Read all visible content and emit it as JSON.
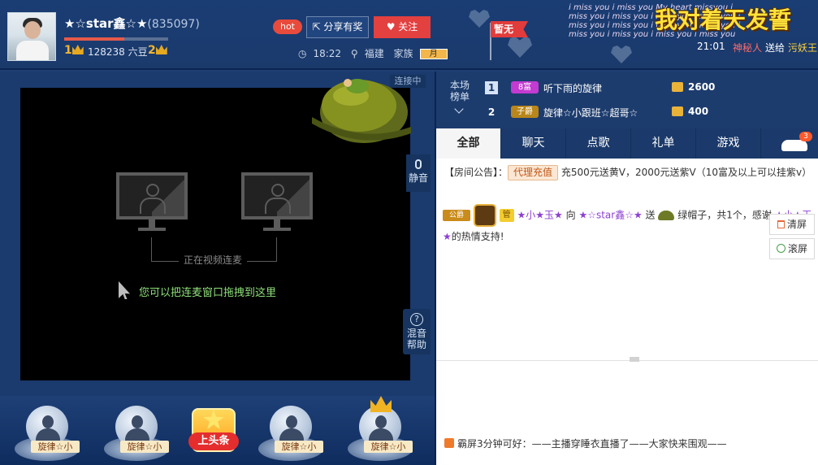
{
  "header": {
    "anchor_name": "★☆star鑫☆★",
    "anchor_id": "(835097)",
    "level_left": "1",
    "level_right": "2",
    "level_progress": 0.58,
    "beans": "128238 六豆",
    "hot": "hot",
    "share_label": "分享有奖",
    "follow_label": "关注",
    "time": "18:22",
    "location": "福建",
    "family_label": "家族",
    "family_badge": "月",
    "flag_label": "暂无",
    "banner_text": "我对着天发誓",
    "missyou_text": "i miss you i miss you My heart missyou i miss you i miss you i miss you i miss you i miss you i miss you i miss you i miss you i miss you i miss you i miss you i miss you",
    "gift_time": "21:01",
    "gift_from": "神秘人",
    "gift_verb": "送给",
    "gift_to": "污妖王"
  },
  "video": {
    "connecting_tag": "连接中",
    "connect_text": "正在视频连麦",
    "drag_hint": "您可以把连麦窗口拖拽到这里",
    "mute_label": "静音",
    "help_label_1": "混音",
    "help_label_2": "帮助",
    "help_glyph": "?"
  },
  "seats": [
    {
      "name": "旋律☆小"
    },
    {
      "name": "旋律☆小"
    },
    {
      "name": "旋律☆小"
    },
    {
      "name": "旋律☆小"
    }
  ],
  "headline_label": "上头条",
  "rank": {
    "title": "本场榜单",
    "rows": [
      {
        "num": "1",
        "badge": "8富",
        "badge_color": "#c33bd1",
        "name": "听下雨的旋律",
        "score": "2600"
      },
      {
        "num": "2",
        "badge": "子爵",
        "badge_color": "#b8861a",
        "name": "旋律☆小跟班☆超哥☆",
        "score": "400"
      }
    ]
  },
  "tabs": [
    "全部",
    "聊天",
    "点歌",
    "礼单",
    "游戏"
  ],
  "car_badge": "3",
  "chat": {
    "notice_prefix": "【房间公告】：",
    "notice_button": "代理充值",
    "notice_text": "充500元送黄V，2000元送紫V（10富及以上可以挂紫v）",
    "msg_tag": "公爵",
    "msg_guan": "管",
    "msg_sender": "★小★玉★",
    "msg_to_word": "向",
    "msg_receiver": "★☆star鑫☆★",
    "msg_send_word": "送",
    "msg_gift": "绿帽子，共1个，感谢",
    "msg_thanks_name": "★小★玉★",
    "msg_tail": "的热情支持!",
    "clear_label": "清屏",
    "scroll_label": "滚屏",
    "sys_msg": "霸屏3分钟可好：——主播穿睡衣直播了——大家快来围观——"
  }
}
